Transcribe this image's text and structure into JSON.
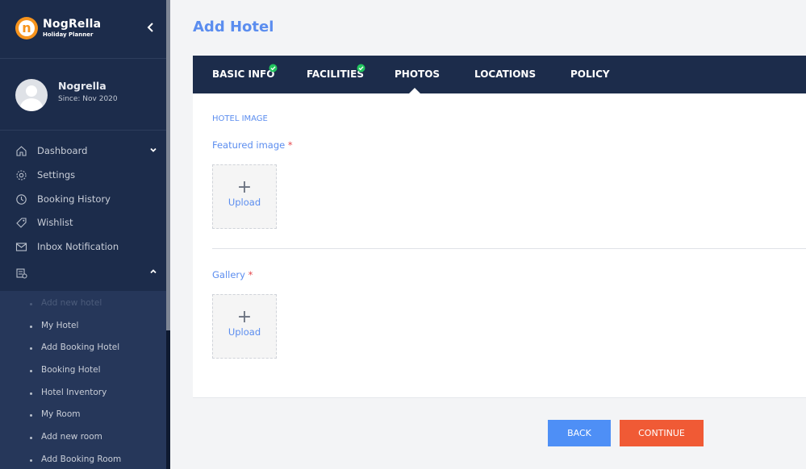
{
  "brand": {
    "name": "NogRella",
    "tagline": "Holiday Planner",
    "logo_letter": "n"
  },
  "profile": {
    "name": "Nogrella",
    "since": "Since: Nov 2020"
  },
  "nav": {
    "items": [
      {
        "label": "Dashboard",
        "icon": "home-icon"
      },
      {
        "label": "Settings",
        "icon": "gear-icon"
      },
      {
        "label": "Booking History",
        "icon": "clock-icon"
      },
      {
        "label": "Wishlist",
        "icon": "tag-icon"
      },
      {
        "label": "Inbox Notification",
        "icon": "mail-icon"
      },
      {
        "label": "",
        "icon": "hotel-add-icon"
      }
    ],
    "submenu": [
      "Add new hotel",
      "My Hotel",
      "Add Booking Hotel",
      "Booking Hotel",
      "Hotel Inventory",
      "My Room",
      "Add new room",
      "Add Booking Room"
    ]
  },
  "page": {
    "title": "Add Hotel"
  },
  "tabs": [
    {
      "label": "BASIC INFO",
      "completed": true
    },
    {
      "label": "FACILITIES",
      "completed": true
    },
    {
      "label": "PHOTOS",
      "active": true
    },
    {
      "label": "LOCATIONS"
    },
    {
      "label": "POLICY"
    }
  ],
  "form": {
    "section_heading": "HOTEL IMAGE",
    "featured_label": "Featured image",
    "gallery_label": "Gallery",
    "required_mark": "*",
    "upload_plus": "+",
    "upload_label": "Upload"
  },
  "actions": {
    "back": "BACK",
    "continue": "CONTINUE"
  },
  "colors": {
    "sidebar_bg": "#1c2c4b",
    "accent": "#5b8def",
    "continue": "#f05a35",
    "back": "#4e8ff6",
    "check": "#22c55e"
  }
}
